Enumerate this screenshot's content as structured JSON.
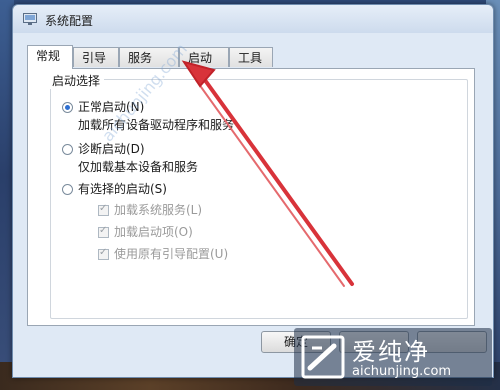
{
  "window": {
    "title": "系统配置"
  },
  "tabs": [
    {
      "label": "常规",
      "active": true
    },
    {
      "label": "引导",
      "active": false
    },
    {
      "label": "服务",
      "active": false
    },
    {
      "label": "启动",
      "active": false
    },
    {
      "label": "工具",
      "active": false
    }
  ],
  "startup": {
    "group_label": "启动选择",
    "normal": {
      "label": "正常启动(N)",
      "desc": "加载所有设备驱动程序和服务",
      "selected": true
    },
    "diagnostic": {
      "label": "诊断启动(D)",
      "desc": "仅加载基本设备和服务",
      "selected": false
    },
    "selective": {
      "label": "有选择的启动(S)",
      "selected": false,
      "options": [
        {
          "label": "加载系统服务(L)",
          "checked": true
        },
        {
          "label": "加载启动项(O)",
          "checked": true
        },
        {
          "label": "使用原有引导配置(U)",
          "checked": true
        }
      ]
    }
  },
  "buttons": {
    "ok": "确定"
  },
  "watermark": {
    "name": "爱纯净",
    "url": "aichunjing.com"
  },
  "colors": {
    "arrow": "#d8333a",
    "accent": "#2e6fd1"
  }
}
